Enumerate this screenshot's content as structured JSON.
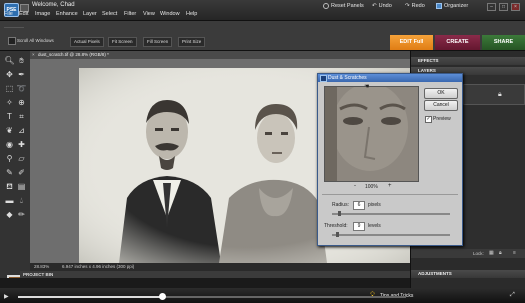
{
  "app": {
    "logo_text": "PSE",
    "welcome": "Welcome, Chad"
  },
  "menu": [
    "File",
    "Edit",
    "Image",
    "Enhance",
    "Layer",
    "Select",
    "Filter",
    "View",
    "Window",
    "Help"
  ],
  "top_buttons": {
    "reset_panels": "Reset Panels",
    "undo": "Undo",
    "redo": "Redo",
    "organizer": "Organizer"
  },
  "options_bar": {
    "scroll_all_windows": "Scroll All Windows",
    "actual_pixels": "Actual Pixels",
    "fit_screen": "Fit Screen",
    "fill_screen": "Fill Screen",
    "print_size": "Print Size"
  },
  "mode_tabs": {
    "edit": "EDIT Full",
    "create": "CREATE",
    "share": "SHARE"
  },
  "document": {
    "title": "dust_scratch.tif @ 28.8% (RGB/8) *",
    "zoom": "28.83%",
    "size_info": "6.947 inches x 4.96 inches (300 ppi)"
  },
  "project_bin": "PROJECT BIN",
  "panels": {
    "effects": "EFFECTS",
    "layers": "LAYERS",
    "lock": "Lock:",
    "adjustments": "ADJUSTMENTS"
  },
  "dialog": {
    "title": "Dust & Scratches",
    "ok": "OK",
    "cancel": "Cancel",
    "preview_label": "Preview",
    "preview_checked": true,
    "zoom": "100%",
    "zoom_out": "-",
    "zoom_in": "+",
    "radius_label": "Radius:",
    "radius_value": "6",
    "radius_unit": "pixels",
    "threshold_label": "Threshold:",
    "threshold_value": "9",
    "threshold_unit": "levels"
  },
  "footer": {
    "tips": "Tips and Tricks",
    "progress": 0.37
  },
  "colors": {
    "edit_tab": "#e88a1e",
    "create_tab": "#7a2342",
    "share_tab": "#326a30",
    "dialog_title": "#4a7cc8"
  }
}
